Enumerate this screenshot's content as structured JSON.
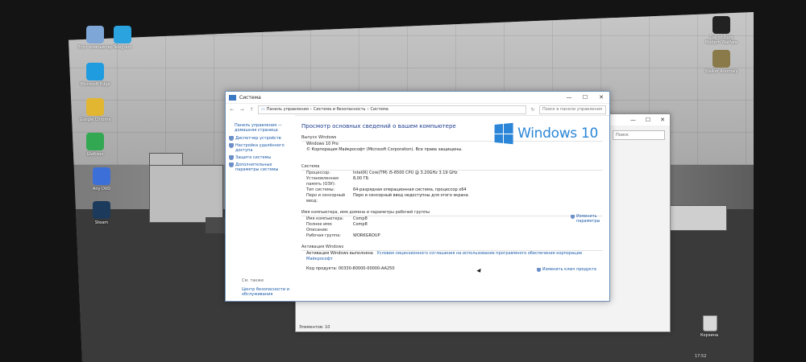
{
  "desktop": {
    "icons_left": [
      {
        "label": "Этот компьютер",
        "color": "#7ea7d8"
      },
      {
        "label": "Telegram",
        "color": "#2aa3df"
      },
      {
        "label": "Microsoft Edge",
        "color": "#1f9be0"
      },
      {
        "label": "Google Chrome",
        "color": "#e2b631"
      },
      {
        "label": "Шаблон",
        "color": "#32a852"
      },
      {
        "label": "Any DVD",
        "color": "#3d6fd8"
      },
      {
        "label": "Steam",
        "color": "#1b3a5c"
      }
    ],
    "icons_right": [
      {
        "label": "Call of Duty Modern Warfare",
        "color": "#222222"
      },
      {
        "label": "Stalker Anomaly",
        "color": "#8a7a4a"
      }
    ],
    "recycle_label": "Корзина",
    "clock": "17:52"
  },
  "explorer_back": {
    "search_placeholder": "Поиск",
    "status": "Элементов: 10",
    "controls": [
      "—",
      "☐",
      "✕"
    ]
  },
  "system_window": {
    "title": "Система",
    "controls": [
      "—",
      "☐",
      "✕"
    ],
    "breadcrumb": [
      "Панель управления",
      "Система и безопасность",
      "Система"
    ],
    "search_placeholder": "Поиск в панели управления",
    "sidebar": {
      "home_link": "Панель управления — домашняя страница",
      "items": [
        "Диспетчер устройств",
        "Настройка удалённого доступа",
        "Защита системы",
        "Дополнительные параметры системы"
      ],
      "see_also": "См. также",
      "see_also_link": "Центр безопасности и обслуживания"
    },
    "heading": "Просмотр основных сведений о вашем компьютере",
    "edition": {
      "section": "Выпуск Windows",
      "name": "Windows 10 Pro",
      "copyright": "© Корпорация Майкрософт (Microsoft Corporation). Все права защищены."
    },
    "logo_text": "Windows 10",
    "system": {
      "section": "Система",
      "rows": [
        {
          "k": "Процессор:",
          "v": "Intel(R) Core(TM) i5-6500 CPU @ 3.20GHz   3.19 GHz"
        },
        {
          "k": "Установленная память (ОЗУ):",
          "v": "8,00 ГБ"
        },
        {
          "k": "Тип системы:",
          "v": "64-разрядная операционная система, процессор x64"
        },
        {
          "k": "Перо и сенсорный ввод:",
          "v": "Перо и сенсорный ввод недоступны для этого экрана"
        }
      ]
    },
    "computer": {
      "section": "Имя компьютера, имя домена и параметры рабочей группы",
      "change_link": "Изменить параметры",
      "rows": [
        {
          "k": "Имя компьютера:",
          "v": "Comp8"
        },
        {
          "k": "Полное имя:",
          "v": "Comp8"
        },
        {
          "k": "Описание:",
          "v": ""
        },
        {
          "k": "Рабочая группа:",
          "v": "WORKGROUP"
        }
      ]
    },
    "activation": {
      "section": "Активация Windows",
      "status_label": "Активация Windows выполнена",
      "license_link": "Условия лицензионного соглашения на использование программного обеспечения корпорации Майкрософт",
      "product_id": "Код продукта: 00330-80000-00000-AA250",
      "change_key_link": "Изменить ключ продукта"
    }
  },
  "colors": {
    "accent": "#2b86d7",
    "link": "#1a5aa8",
    "heading": "#1e3d8f"
  }
}
